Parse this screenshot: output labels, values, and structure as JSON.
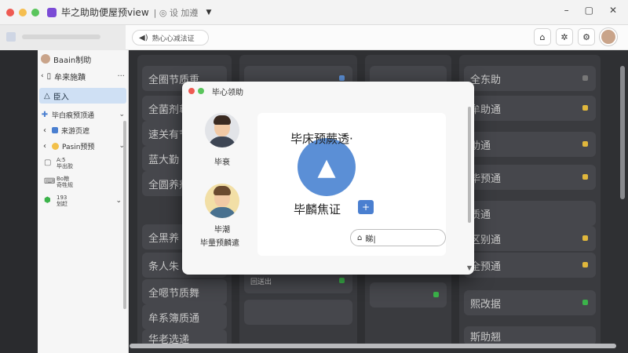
{
  "window": {
    "title": "毕之助助便屋预view",
    "subtitle": "| ◎ 设 加遵",
    "minimize": "–",
    "maximize": "▢",
    "close": "✕"
  },
  "toolbar": {
    "address_text": "熟心心减法证"
  },
  "sidebar": {
    "header": "Baain制助",
    "section": "牟来施蹟",
    "active_item": "臣入",
    "row1": "毕白痕预顶通",
    "row2": "来游页遮",
    "row3": "Pasin预预",
    "items": [
      {
        "line1": "A:5",
        "line2": "毕出胶"
      },
      {
        "line1": "Bo粮",
        "line2": "奇牲规"
      },
      {
        "line1": "193",
        "line2": "划赶"
      }
    ]
  },
  "dashboard": {
    "columns": [
      {
        "cards": [
          {
            "text": "全圈节质重"
          },
          {
            "text": "全菌剂尊"
          },
          {
            "text": "速关有节"
          },
          {
            "text": "蓝大勤"
          },
          {
            "text": "全圆养剂"
          },
          {
            "text": "全黑养"
          },
          {
            "text": "条人朱"
          },
          {
            "text": "全嗯节质舞"
          },
          {
            "text": "牟系簿质通"
          },
          {
            "text": "华老选递"
          }
        ]
      },
      {
        "cards": [
          {
            "text": ""
          },
          {
            "text": ""
          },
          {
            "text": ""
          },
          {
            "text": ""
          },
          {
            "text": ""
          },
          {
            "text": ""
          },
          {
            "text": ""
          },
          {
            "text": "回送出"
          },
          {
            "text": ""
          }
        ]
      },
      {
        "cards": [
          {
            "text": ""
          },
          {
            "text": ""
          },
          {
            "text": ""
          },
          {
            "text": ""
          },
          {
            "text": ""
          },
          {
            "text": ""
          },
          {
            "text": ""
          },
          {
            "text": ""
          },
          {
            "text": ""
          }
        ]
      },
      {
        "cards": [
          {
            "text": "全东助"
          },
          {
            "text": "牟助通"
          },
          {
            "text": "助通"
          },
          {
            "text": "毕预通"
          },
          {
            "text": "质通"
          },
          {
            "text": "区别通"
          },
          {
            "text": "全预通"
          },
          {
            "text": "熙改据"
          },
          {
            "text": "斯助翘"
          }
        ]
      }
    ]
  },
  "modal": {
    "title": "毕心领助",
    "person1": {
      "name": "毕衰"
    },
    "person2": {
      "name": "毕潮",
      "subtitle": "毕量预麟遣"
    },
    "panel_title": "毕床预蕨透·",
    "panel_subtitle": "毕麟焦证",
    "plus_label": "+",
    "input_value": "睇|"
  }
}
